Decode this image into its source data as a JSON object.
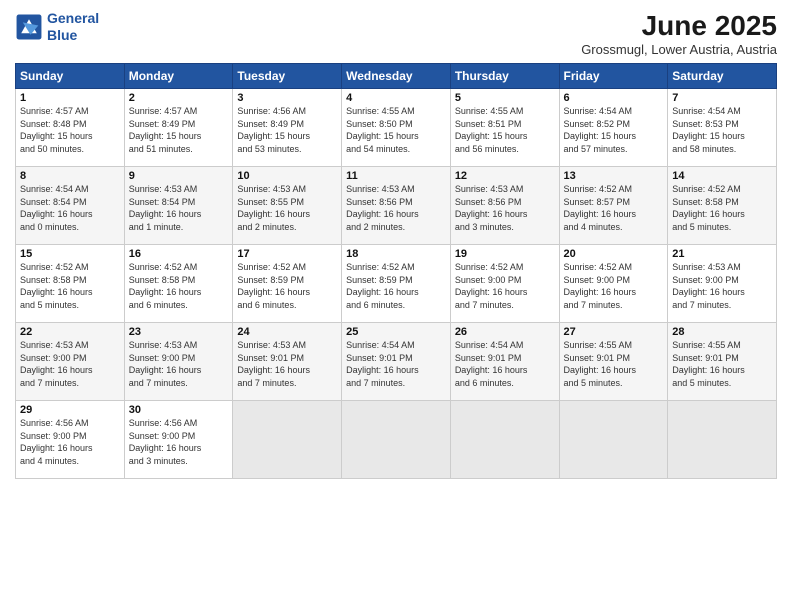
{
  "header": {
    "logo_line1": "General",
    "logo_line2": "Blue",
    "month": "June 2025",
    "location": "Grossmugl, Lower Austria, Austria"
  },
  "weekdays": [
    "Sunday",
    "Monday",
    "Tuesday",
    "Wednesday",
    "Thursday",
    "Friday",
    "Saturday"
  ],
  "weeks": [
    [
      {
        "day": "1",
        "info": "Sunrise: 4:57 AM\nSunset: 8:48 PM\nDaylight: 15 hours\nand 50 minutes."
      },
      {
        "day": "2",
        "info": "Sunrise: 4:57 AM\nSunset: 8:49 PM\nDaylight: 15 hours\nand 51 minutes."
      },
      {
        "day": "3",
        "info": "Sunrise: 4:56 AM\nSunset: 8:49 PM\nDaylight: 15 hours\nand 53 minutes."
      },
      {
        "day": "4",
        "info": "Sunrise: 4:55 AM\nSunset: 8:50 PM\nDaylight: 15 hours\nand 54 minutes."
      },
      {
        "day": "5",
        "info": "Sunrise: 4:55 AM\nSunset: 8:51 PM\nDaylight: 15 hours\nand 56 minutes."
      },
      {
        "day": "6",
        "info": "Sunrise: 4:54 AM\nSunset: 8:52 PM\nDaylight: 15 hours\nand 57 minutes."
      },
      {
        "day": "7",
        "info": "Sunrise: 4:54 AM\nSunset: 8:53 PM\nDaylight: 15 hours\nand 58 minutes."
      }
    ],
    [
      {
        "day": "8",
        "info": "Sunrise: 4:54 AM\nSunset: 8:54 PM\nDaylight: 16 hours\nand 0 minutes."
      },
      {
        "day": "9",
        "info": "Sunrise: 4:53 AM\nSunset: 8:54 PM\nDaylight: 16 hours\nand 1 minute."
      },
      {
        "day": "10",
        "info": "Sunrise: 4:53 AM\nSunset: 8:55 PM\nDaylight: 16 hours\nand 2 minutes."
      },
      {
        "day": "11",
        "info": "Sunrise: 4:53 AM\nSunset: 8:56 PM\nDaylight: 16 hours\nand 2 minutes."
      },
      {
        "day": "12",
        "info": "Sunrise: 4:53 AM\nSunset: 8:56 PM\nDaylight: 16 hours\nand 3 minutes."
      },
      {
        "day": "13",
        "info": "Sunrise: 4:52 AM\nSunset: 8:57 PM\nDaylight: 16 hours\nand 4 minutes."
      },
      {
        "day": "14",
        "info": "Sunrise: 4:52 AM\nSunset: 8:58 PM\nDaylight: 16 hours\nand 5 minutes."
      }
    ],
    [
      {
        "day": "15",
        "info": "Sunrise: 4:52 AM\nSunset: 8:58 PM\nDaylight: 16 hours\nand 5 minutes."
      },
      {
        "day": "16",
        "info": "Sunrise: 4:52 AM\nSunset: 8:58 PM\nDaylight: 16 hours\nand 6 minutes."
      },
      {
        "day": "17",
        "info": "Sunrise: 4:52 AM\nSunset: 8:59 PM\nDaylight: 16 hours\nand 6 minutes."
      },
      {
        "day": "18",
        "info": "Sunrise: 4:52 AM\nSunset: 8:59 PM\nDaylight: 16 hours\nand 6 minutes."
      },
      {
        "day": "19",
        "info": "Sunrise: 4:52 AM\nSunset: 9:00 PM\nDaylight: 16 hours\nand 7 minutes."
      },
      {
        "day": "20",
        "info": "Sunrise: 4:52 AM\nSunset: 9:00 PM\nDaylight: 16 hours\nand 7 minutes."
      },
      {
        "day": "21",
        "info": "Sunrise: 4:53 AM\nSunset: 9:00 PM\nDaylight: 16 hours\nand 7 minutes."
      }
    ],
    [
      {
        "day": "22",
        "info": "Sunrise: 4:53 AM\nSunset: 9:00 PM\nDaylight: 16 hours\nand 7 minutes."
      },
      {
        "day": "23",
        "info": "Sunrise: 4:53 AM\nSunset: 9:00 PM\nDaylight: 16 hours\nand 7 minutes."
      },
      {
        "day": "24",
        "info": "Sunrise: 4:53 AM\nSunset: 9:01 PM\nDaylight: 16 hours\nand 7 minutes."
      },
      {
        "day": "25",
        "info": "Sunrise: 4:54 AM\nSunset: 9:01 PM\nDaylight: 16 hours\nand 7 minutes."
      },
      {
        "day": "26",
        "info": "Sunrise: 4:54 AM\nSunset: 9:01 PM\nDaylight: 16 hours\nand 6 minutes."
      },
      {
        "day": "27",
        "info": "Sunrise: 4:55 AM\nSunset: 9:01 PM\nDaylight: 16 hours\nand 5 minutes."
      },
      {
        "day": "28",
        "info": "Sunrise: 4:55 AM\nSunset: 9:01 PM\nDaylight: 16 hours\nand 5 minutes."
      }
    ],
    [
      {
        "day": "29",
        "info": "Sunrise: 4:56 AM\nSunset: 9:00 PM\nDaylight: 16 hours\nand 4 minutes."
      },
      {
        "day": "30",
        "info": "Sunrise: 4:56 AM\nSunset: 9:00 PM\nDaylight: 16 hours\nand 3 minutes."
      },
      {
        "day": "",
        "info": ""
      },
      {
        "day": "",
        "info": ""
      },
      {
        "day": "",
        "info": ""
      },
      {
        "day": "",
        "info": ""
      },
      {
        "day": "",
        "info": ""
      }
    ]
  ]
}
